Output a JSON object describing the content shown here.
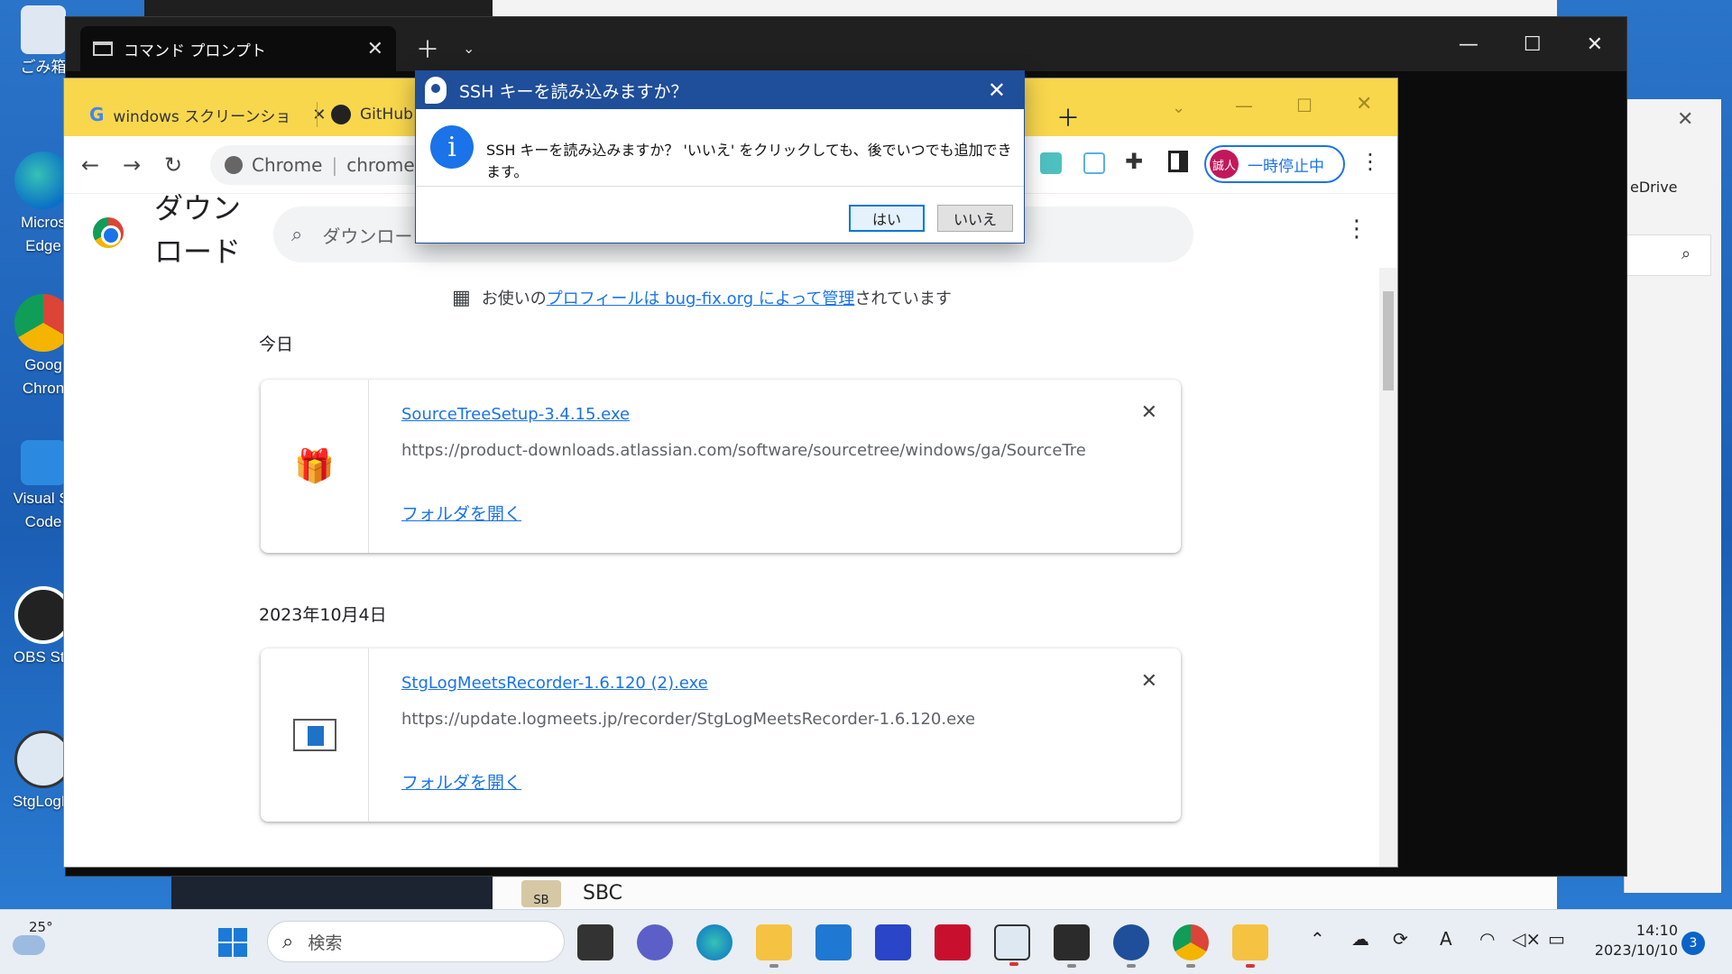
{
  "desktop": {
    "icons": [
      {
        "label": "ごみ箱"
      },
      {
        "label": "Micros"
      },
      {
        "label": "Edge"
      },
      {
        "label": "Goog"
      },
      {
        "label": "Chron"
      },
      {
        "label": "Visual St"
      },
      {
        "label": "Code"
      },
      {
        "label": "OBS Stu"
      },
      {
        "label": "StgLogM"
      }
    ]
  },
  "cmd": {
    "tab_title": "コマンド プロンプト"
  },
  "explorer": {
    "onedrive_label": "eDrive"
  },
  "chrome": {
    "tabs": [
      {
        "title": "windows スクリーンショ"
      },
      {
        "title": "GitHub"
      }
    ],
    "omnibox": {
      "scheme": "Chrome",
      "url": "chrome:"
    },
    "profile": {
      "avatar_text": "誠人",
      "status": "一時停止中"
    },
    "downloads": {
      "page_title_line1": "ダウン",
      "page_title_line2": "ロード",
      "search_placeholder": "ダウンロー",
      "managed_prefix": "お使いの",
      "managed_link": "プロフィールは bug-fix.org によって管理",
      "managed_suffix": "されています",
      "groups": [
        {
          "date": "今日",
          "items": [
            {
              "filename": "SourceTreeSetup-3.4.15.exe",
              "url": "https://product-downloads.atlassian.com/software/sourcetree/windows/ga/SourceTre...",
              "open_folder": "フォルダを開く"
            }
          ]
        },
        {
          "date": "2023年10月4日",
          "items": [
            {
              "filename": "StgLogMeetsRecorder-1.6.120 (2).exe",
              "url": "https://update.logmeets.jp/recorder/StgLogMeetsRecorder-1.6.120.exe",
              "open_folder": "フォルダを開く"
            }
          ]
        }
      ]
    }
  },
  "dialog": {
    "title": "SSH キーを読み込みますか？",
    "message": "SSH キーを読み込みますか？ 'いいえ' をクリックしても、後でいつでも追加できます。",
    "yes": "はい",
    "no": "いいえ"
  },
  "background_window": {
    "sbc_avatar": "SB",
    "sbc_label": "SBC"
  },
  "taskbar": {
    "weather_temp": "25°",
    "search_placeholder": "検索",
    "time": "14:10",
    "date": "2023/10/10",
    "notification_count": "3"
  },
  "colors": {
    "chrome_tabstrip": "#f8d74d",
    "dialog_titlebar": "#1f4e9a",
    "link": "#1a73e8"
  }
}
